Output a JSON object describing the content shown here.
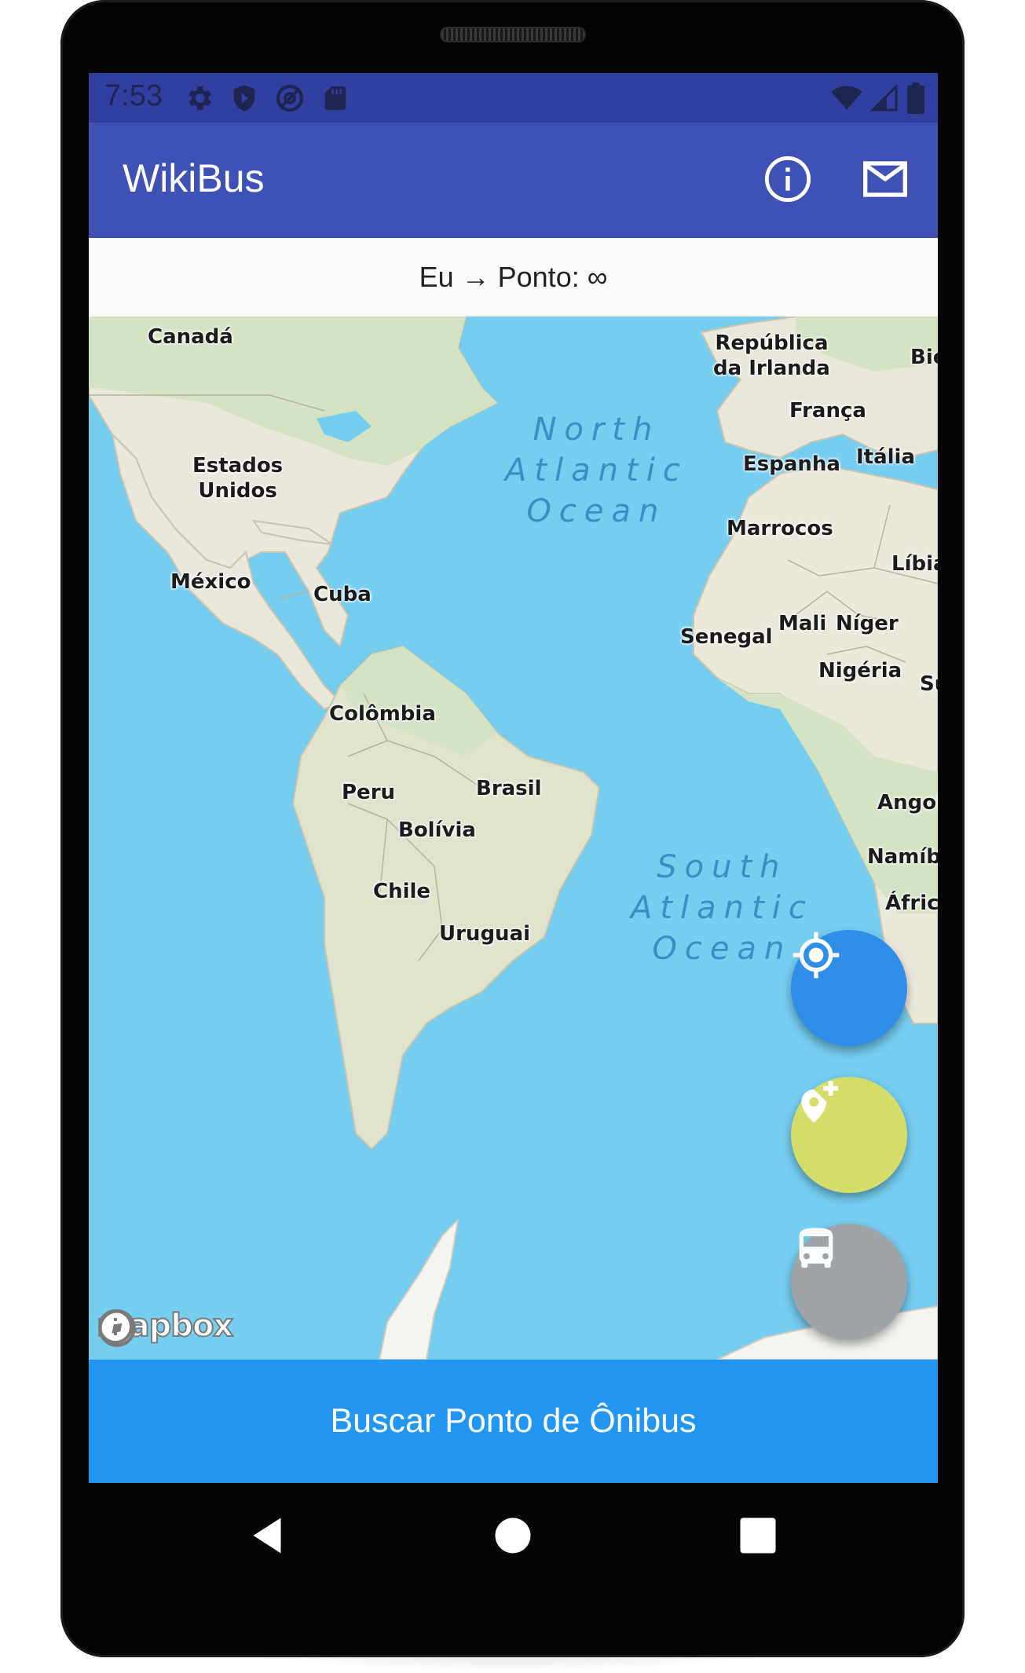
{
  "status_bar": {
    "time": "7:53",
    "icons": [
      "gear-icon",
      "shield-icon",
      "at-sign-icon",
      "sd-card-icon"
    ],
    "right_icons": [
      "wifi-icon",
      "cell-signal-icon",
      "battery-icon"
    ]
  },
  "app_bar": {
    "title": "WikiBus",
    "actions": [
      "info-icon",
      "mail-icon"
    ]
  },
  "distance": {
    "text": "Eu → Ponto: ∞"
  },
  "map": {
    "attribution": "mapbox",
    "countries": {
      "canada": "Canadá",
      "irlanda": "República\nda Irlanda",
      "bie": "Bie",
      "franca": "França",
      "espanha": "Espanha",
      "italia": "Itália",
      "estados_unidos": "Estados\nUnidos",
      "marrocos": "Marrocos",
      "libia": "Líbia",
      "mexico": "México",
      "cuba": "Cuba",
      "senegal": "Senegal",
      "mali": "Mali",
      "niger": "Níger",
      "nigeria": "Nigéria",
      "su": "Su",
      "colombia": "Colômbia",
      "brasil": "Brasil",
      "peru": "Peru",
      "bolivia": "Bolívia",
      "angola": "Angol",
      "namibia": "Namíbi",
      "chile": "Chile",
      "africa": "Áfric",
      "uruguai": "Uruguai"
    },
    "oceans": {
      "north_atlantic": "North\nAtlantic\nOcean",
      "south_atlantic": "South\nAtlantic\nOcean"
    },
    "colors": {
      "water": "#75cdf0",
      "land": "#e8e6d8",
      "land_green": "#d4e3c4"
    }
  },
  "fabs": {
    "locate": {
      "icon": "crosshair-icon",
      "color": "#2f8ee8"
    },
    "add_stop": {
      "icon": "add-location-icon",
      "color": "#d4dc6a"
    },
    "bus": {
      "icon": "bus-icon",
      "color": "#9ea4a8"
    }
  },
  "bottom_button": {
    "label": "Buscar Ponto de Ônibus",
    "color": "#2196f3"
  },
  "nav_bar": [
    "back-icon",
    "home-icon",
    "recents-icon"
  ]
}
